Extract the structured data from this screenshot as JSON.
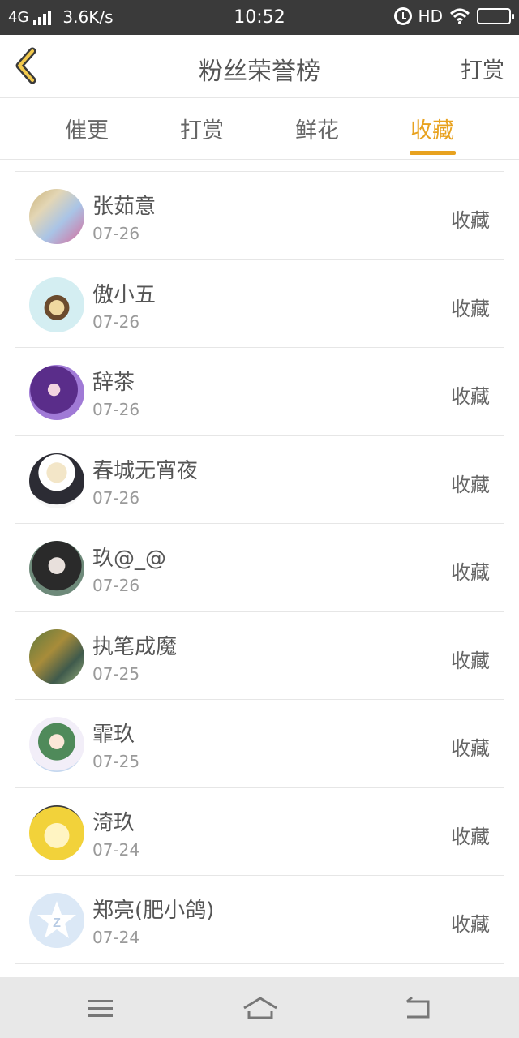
{
  "status_bar": {
    "network": "4G",
    "speed": "3.6K/s",
    "time": "10:52",
    "hd": "HD"
  },
  "header": {
    "title": "粉丝荣誉榜",
    "action": "打赏"
  },
  "tabs": [
    {
      "label": "催更",
      "active": false
    },
    {
      "label": "打赏",
      "active": false
    },
    {
      "label": "鲜花",
      "active": false
    },
    {
      "label": "收藏",
      "active": true
    }
  ],
  "accent_color": "#e8a21f",
  "list": [
    {
      "name": "张茹意",
      "date": "07-26",
      "action": "收藏"
    },
    {
      "name": "傲小五",
      "date": "07-26",
      "action": "收藏"
    },
    {
      "name": "辞茶",
      "date": "07-26",
      "action": "收藏"
    },
    {
      "name": "春城无宵夜",
      "date": "07-26",
      "action": "收藏"
    },
    {
      "name": "玖@_@",
      "date": "07-26",
      "action": "收藏"
    },
    {
      "name": "执笔成魔",
      "date": "07-25",
      "action": "收藏"
    },
    {
      "name": "霏玖",
      "date": "07-25",
      "action": "收藏"
    },
    {
      "name": "渏玖",
      "date": "07-24",
      "action": "收藏"
    },
    {
      "name": "郑亮(肥小鸽)",
      "date": "07-24",
      "action": "收藏"
    }
  ],
  "nav": {
    "menu_icon": "menu-icon",
    "home_icon": "home-icon",
    "back_icon": "return-icon"
  }
}
